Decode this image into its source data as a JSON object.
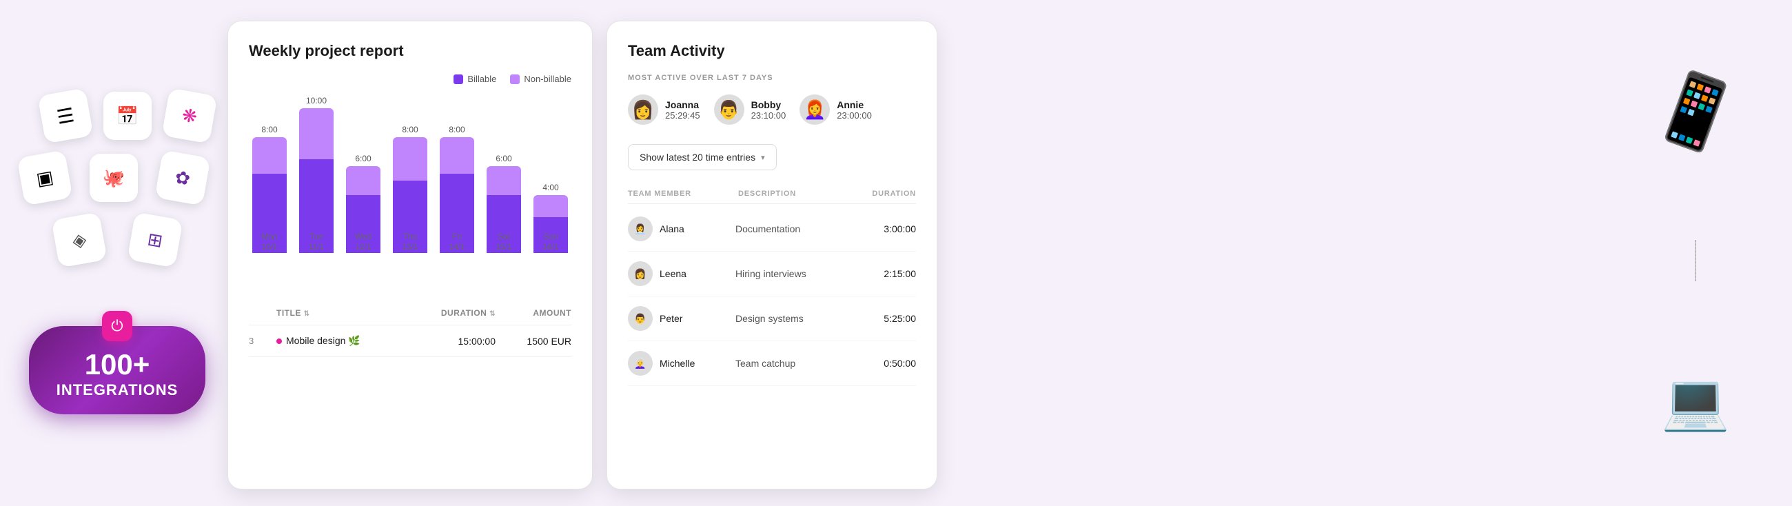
{
  "integrations": {
    "count": "100+",
    "label": "INTEGRATIONS"
  },
  "weeklyReport": {
    "title": "Weekly project report",
    "legend": {
      "billable": "Billable",
      "nonBillable": "Non-billable"
    },
    "bars": [
      {
        "day": "Mon",
        "date": "10/1",
        "total": 8,
        "billable": 5.5,
        "nonBillable": 2.5,
        "label": "8:00"
      },
      {
        "day": "Tue",
        "date": "11/1",
        "total": 10,
        "billable": 6.5,
        "nonBillable": 3.5,
        "label": "10:00"
      },
      {
        "day": "Wed",
        "date": "12/1",
        "total": 6,
        "billable": 4,
        "nonBillable": 2,
        "label": "6:00"
      },
      {
        "day": "Thu",
        "date": "13/1",
        "total": 8,
        "billable": 5,
        "nonBillable": 3,
        "label": "8:00"
      },
      {
        "day": "Fri",
        "date": "14/1",
        "total": 8,
        "billable": 5.5,
        "nonBillable": 2.5,
        "label": "8:00"
      },
      {
        "day": "Sat",
        "date": "15/1",
        "total": 6,
        "billable": 4,
        "nonBillable": 2,
        "label": "6:00"
      },
      {
        "day": "Sun",
        "date": "16/1",
        "total": 4,
        "billable": 2.5,
        "nonBillable": 1.5,
        "label": "4:00"
      }
    ],
    "maxHours": 10,
    "tableHeaders": {
      "title": "TITLE",
      "duration": "DURATION",
      "amount": "AMOUNT"
    },
    "tableRows": [
      {
        "num": "3",
        "title": "Mobile design 🌿",
        "duration": "15:00:00",
        "amount": "1500 EUR"
      }
    ]
  },
  "teamActivity": {
    "title": "Team Activity",
    "mostActiveLabel": "MOST ACTIVE OVER LAST 7 DAYS",
    "topUsers": [
      {
        "name": "Joanna",
        "time": "25:29:45",
        "avatar": "joanna"
      },
      {
        "name": "Bobby",
        "time": "23:10:00",
        "avatar": "bobby"
      },
      {
        "name": "Annie",
        "time": "23:00:00",
        "avatar": "annie"
      }
    ],
    "dropdownLabel": "Show latest 20 time entries",
    "tableHeaders": {
      "member": "TEAM MEMBER",
      "description": "DESCRIPTION",
      "duration": "DURATION"
    },
    "entries": [
      {
        "name": "Alana",
        "description": "Documentation",
        "duration": "3:00:00",
        "avatar": "alana"
      },
      {
        "name": "Leena",
        "description": "Hiring interviews",
        "duration": "2:15:00",
        "avatar": "leena"
      },
      {
        "name": "Peter",
        "description": "Design systems",
        "duration": "5:25:00",
        "avatar": "peter"
      },
      {
        "name": "Michelle",
        "description": "Team catchup",
        "duration": "0:50:00",
        "avatar": "michelle"
      }
    ]
  }
}
